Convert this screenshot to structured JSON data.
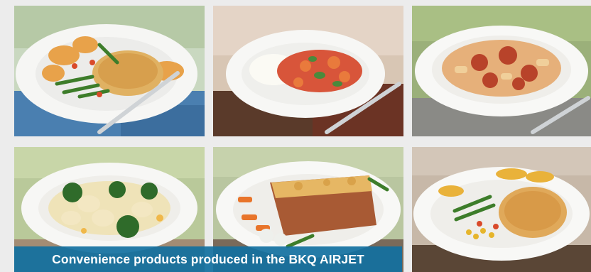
{
  "caption": {
    "text": "Convenience products produced in the BKQ AIRJET"
  },
  "colors": {
    "background": "#ececec",
    "caption_bg": "#1170a0",
    "caption_text": "#ffffff"
  },
  "gallery": {
    "images": [
      {
        "icon": "plate-chicken-potatoes-beans-image"
      },
      {
        "icon": "plate-rice-stirfry-image"
      },
      {
        "icon": "plate-rigatoni-meatballs-image"
      },
      {
        "icon": "plate-tortellini-broccoli-image"
      },
      {
        "icon": "plate-lasagne-vegetables-image"
      },
      {
        "icon": "plate-schnitzel-wedges-vegetables-image"
      }
    ]
  }
}
